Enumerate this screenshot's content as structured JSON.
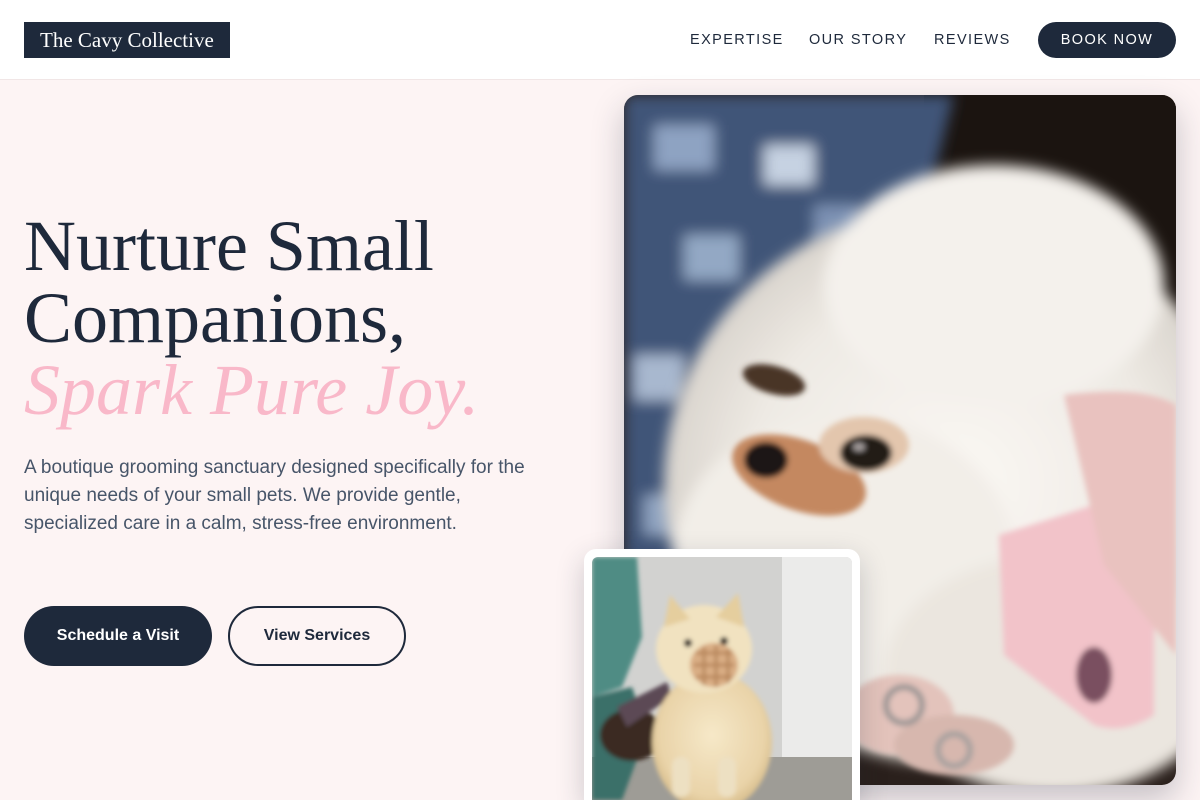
{
  "header": {
    "logo": "The Cavy Collective",
    "nav": [
      "EXPERTISE",
      "OUR STORY",
      "REVIEWS"
    ],
    "book_label": "BOOK NOW"
  },
  "hero": {
    "headline_line1": "Nurture Small",
    "headline_line2": "Companions,",
    "headline_accent": "Spark Pure Joy.",
    "description": "A boutique grooming sanctuary designed specifically for the unique needs of your small pets. We provide gentle, specialized care in a calm, stress-free environment.",
    "primary_cta": "Schedule a Visit",
    "secondary_cta": "View Services"
  },
  "colors": {
    "navy": "#1e293b",
    "pink_accent": "#f9b8c9",
    "page_background": "#fdf4f4"
  },
  "images": {
    "main": "fluffy-white-dog-photo",
    "secondary": "groomed-pomeranian-photo"
  }
}
